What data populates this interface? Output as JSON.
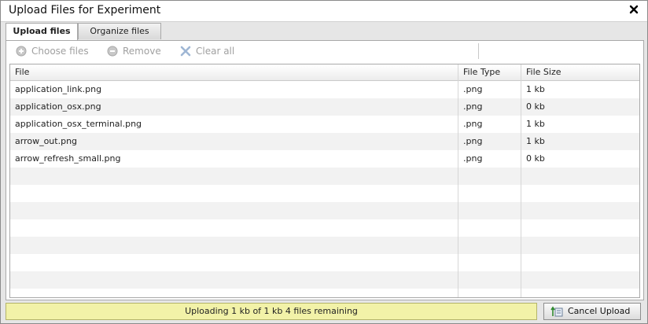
{
  "window": {
    "title": "Upload Files for Experiment",
    "close_icon": "close-icon"
  },
  "tabs": [
    {
      "label": "Upload files",
      "active": true
    },
    {
      "label": "Organize files",
      "active": false
    }
  ],
  "toolbar": {
    "choose_label": "Choose files",
    "remove_label": "Remove",
    "clear_label": "Clear all"
  },
  "table": {
    "columns": [
      "File",
      "File Type",
      "File Size"
    ],
    "rows": [
      {
        "file": "application_link.png",
        "type": ".png",
        "size": "1 kb"
      },
      {
        "file": "application_osx.png",
        "type": ".png",
        "size": "0 kb"
      },
      {
        "file": "application_osx_terminal.png",
        "type": ".png",
        "size": "1 kb"
      },
      {
        "file": "arrow_out.png",
        "type": ".png",
        "size": "1 kb"
      },
      {
        "file": "arrow_refresh_small.png",
        "type": ".png",
        "size": "0 kb"
      }
    ]
  },
  "status": {
    "text": "Uploading 1 kb of 1 kb 4 files remaining"
  },
  "cancel": {
    "label": "Cancel Upload"
  },
  "colors": {
    "status_bg": "#f2f2a8",
    "row_alt": "#f2f2f2",
    "disabled_text": "#a0a0a0"
  }
}
